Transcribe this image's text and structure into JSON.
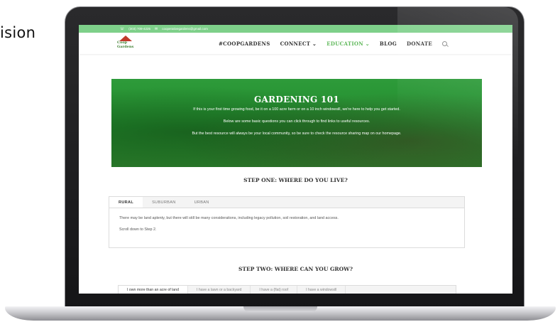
{
  "background_text": "ision",
  "topbar": {
    "phone": "(303) 709-4225",
    "email": "cooperativegardens@gmail.com"
  },
  "logo": {
    "line1": "Coop",
    "line2": "Gardens"
  },
  "nav": {
    "items": [
      "#COOPGARDENS",
      "CONNECT ⌄",
      "EDUCATION ⌄",
      "BLOG",
      "DONATE"
    ]
  },
  "hero": {
    "title": "GARDENING 101",
    "line1": "If this is your first time growing food, be it on a 100 acre farm or on a 10 inch windowsill, we're here to help you get started.",
    "line2": "Below are some basic questions you can click through to find links to useful resources.",
    "line3": "But the best resource will always be your local community, so be sure to check the resource sharing map on our homepage."
  },
  "step_one": {
    "heading": "STEP ONE: WHERE DO YOU LIVE?",
    "tabs": [
      "RURAL",
      "SUBURBAN",
      "URBAN"
    ],
    "body1": "There may be land aplenty, but there will still be many considerations, including legacy pollution, soil restoration, and land access.",
    "body2": "Scroll down to Step 2."
  },
  "step_two": {
    "heading": "STEP TWO: WHERE CAN YOU GROW?",
    "tabs": [
      "I own more than an acre of land",
      "I have a lawn or a backyard",
      "I have a (flat) roof",
      "I have a windowsill"
    ]
  },
  "colors": {
    "topbar": "#7ed08a",
    "hero_green": "#1f8a2c",
    "accent_nav": "#5fb85a"
  }
}
